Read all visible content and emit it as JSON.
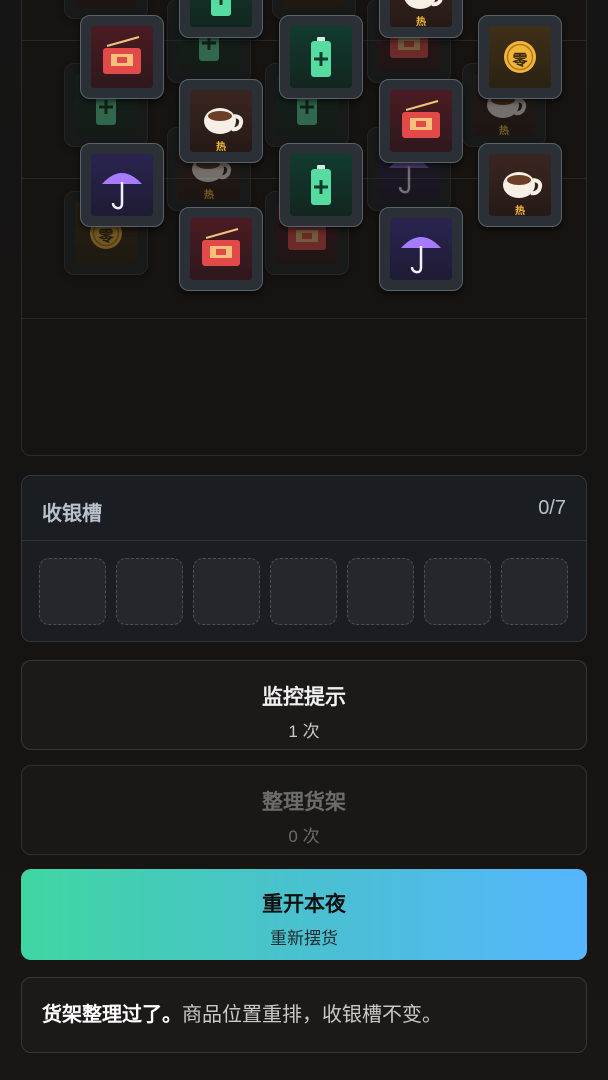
{
  "tray": {
    "title": "收银槽",
    "count": "0/7",
    "slot_count": 7
  },
  "buttons": {
    "hint": {
      "label": "监控提示",
      "count": "1 次"
    },
    "tidy": {
      "label": "整理货架",
      "count": "0 次",
      "enabled": false
    },
    "restart": {
      "label": "重开本夜",
      "sub": "重新摆货"
    }
  },
  "message": {
    "bold": "货架整理过了。",
    "text": "商品位置重排，收银槽不变。"
  },
  "tiles": {
    "coffee_mark": "热",
    "coin_mark": "零",
    "kinds": [
      "red-envelope-icon",
      "battery-icon",
      "coffee-cup-icon",
      "umbrella-icon",
      "coin-icon"
    ]
  },
  "colors": {
    "accent_start": "#3fd6a2",
    "accent_end": "#55b6ff"
  }
}
